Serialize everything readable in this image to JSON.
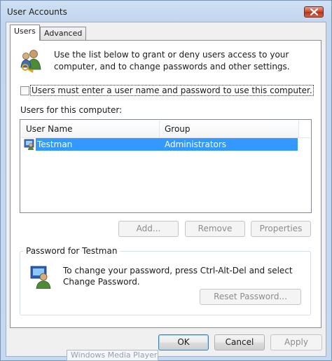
{
  "window": {
    "title": "User Accounts"
  },
  "tabs": [
    {
      "label": "Users",
      "active": true
    },
    {
      "label": "Advanced",
      "active": false
    }
  ],
  "intro_text": "Use the list below to grant or deny users access to your computer, and to change passwords and other settings.",
  "checkbox": {
    "label": "Users must enter a user name and password to use this computer.",
    "checked": false
  },
  "users_list": {
    "label": "Users for this computer:",
    "columns": [
      "User Name",
      "Group"
    ],
    "rows": [
      {
        "user_name": "Testman",
        "group": "Administrators",
        "selected": true
      }
    ]
  },
  "list_buttons": {
    "add": "Add...",
    "remove": "Remove",
    "properties": "Properties"
  },
  "password_group": {
    "title": "Password for Testman",
    "text": "To change your password, press Ctrl-Alt-Del and select Change Password.",
    "reset_button": "Reset Password..."
  },
  "dialog_buttons": {
    "ok": "OK",
    "cancel": "Cancel",
    "apply": "Apply"
  },
  "tooltip": "Windows Media Player",
  "colors": {
    "selection": "#3399ff",
    "close_button": "#c7472b",
    "frame": "#c6d9ef"
  }
}
